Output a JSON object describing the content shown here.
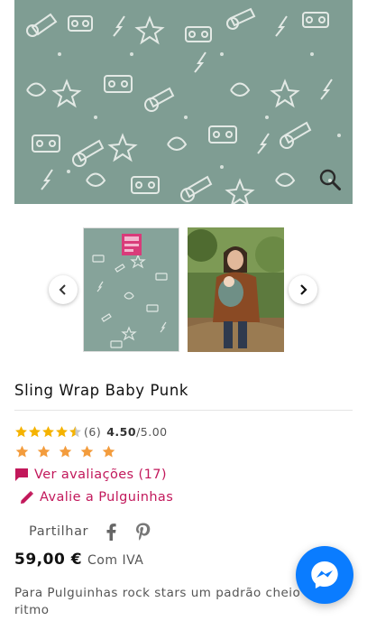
{
  "product": {
    "title": "Sling Wrap Baby Punk",
    "rating": {
      "count": "(6)",
      "average": "4.50",
      "max": "/5.00",
      "stars_filled": 4.5
    },
    "reviews_link": "Ver avaliações (17)",
    "rate_link": "Avalie a Pulguinhas",
    "share_label": "Partilhar",
    "price": "59,00 €",
    "tax_note": "Com IVA",
    "description": "Para Pulguinhas rock stars um padrão cheio de ritmo"
  },
  "icons": {
    "zoom": "zoom-icon",
    "prev": "chevron-left-icon",
    "next": "chevron-right-icon",
    "reviews": "comment-icon",
    "rate": "pencil-icon",
    "facebook": "facebook-icon",
    "pinterest": "pinterest-icon",
    "messenger": "messenger-icon"
  },
  "colors": {
    "accent": "#c2185b",
    "star_gold": "#f5b301",
    "star_orange": "#f39c3d",
    "fabric": "#7f9d93",
    "messenger": "#0a7cff"
  }
}
